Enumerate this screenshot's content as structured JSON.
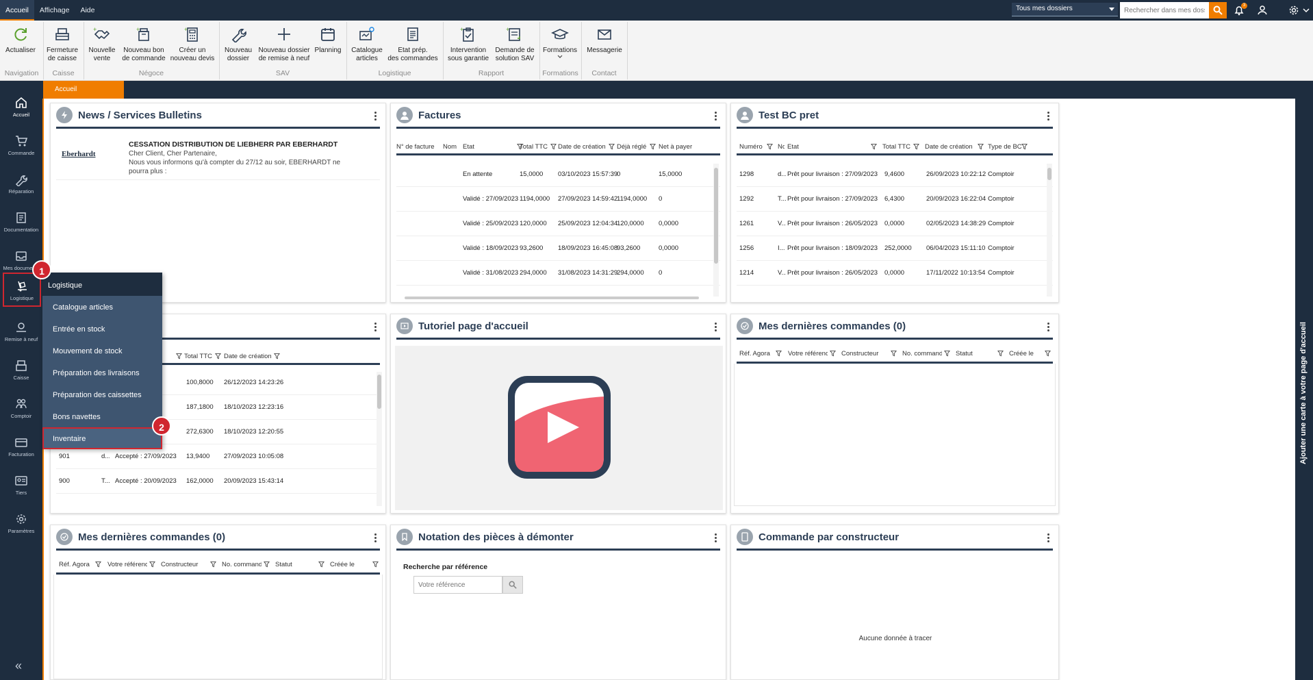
{
  "menubar": {
    "items": [
      "Accueil",
      "Affichage",
      "Aide"
    ]
  },
  "topbar": {
    "dossier_select": "Tous mes dossiers",
    "search_placeholder": "Rechercher dans mes dossiers",
    "notification_count": "3"
  },
  "ribbon": {
    "buttons": {
      "actualiser": "Actualiser",
      "fermeture_l1": "Fermeture",
      "fermeture_l2": "de caisse",
      "nouvelle_vente_l1": "Nouvelle",
      "nouvelle_vente_l2": "vente",
      "bon_cmd_l1": "Nouveau bon",
      "bon_cmd_l2": "de commande",
      "devis_l1": "Créer un",
      "devis_l2": "nouveau devis",
      "nouveau_dossier_l1": "Nouveau",
      "nouveau_dossier_l2": "dossier",
      "remise_l1": "Nouveau dossier",
      "remise_l2": "de remise à neuf",
      "planning": "Planning",
      "catalogue_l1": "Catalogue",
      "catalogue_l2": "articles",
      "etat_l1": "Etat prép.",
      "etat_l2": "des commandes",
      "intervention_l1": "Intervention",
      "intervention_l2": "sous garantie",
      "demande_l1": "Demande de",
      "demande_l2": "solution SAV",
      "formations": "Formations",
      "messagerie": "Messagerie"
    },
    "groups": {
      "navigation": "Navigation",
      "caisse": "Caisse",
      "negoce": "Négoce",
      "sav": "SAV",
      "logistique": "Logistique",
      "rapport": "Rapport",
      "formations": "Formations",
      "contact": "Contact"
    }
  },
  "tab": {
    "active": "Accueil"
  },
  "leftnav": {
    "items": [
      "Accueil",
      "Commande",
      "Réparation",
      "Documentation",
      "Mes documents",
      "Logistique",
      "Remise à neuf",
      "Caisse",
      "Comptoir",
      "Facturation",
      "Tiers",
      "Paramètres"
    ]
  },
  "flyout": {
    "title": "Logistique",
    "items": [
      "Catalogue articles",
      "Entrée en stock",
      "Mouvement de stock",
      "Préparation des livraisons",
      "Préparation des caissettes",
      "Bons navettes",
      "Inventaire"
    ]
  },
  "step_badges": [
    "1",
    "2"
  ],
  "cards": {
    "news": {
      "title": "News / Services Bulletins",
      "logo_text": "Eberhardt",
      "headline": "CESSATION DISTRIBUTION DE LIEBHERR PAR EBERHARDT",
      "line1": "Cher Client, Cher Partenaire,",
      "line2": "Nous vous informons qu'à compter du 27/12 au soir, EBERHARDT ne",
      "line3": "pourra plus :"
    },
    "factures": {
      "title": "Factures",
      "headers": [
        "N° de facture",
        "Nom",
        "Etat",
        "Total TTC",
        "Date de création",
        "Déjà réglé",
        "Net à payer"
      ],
      "rows": [
        [
          "",
          "",
          "En attente",
          "15,0000",
          "03/10/2023 15:57:39",
          "0",
          "15,0000"
        ],
        [
          "",
          "",
          "Validé : 27/09/2023",
          "1194,0000",
          "27/09/2023 14:59:42",
          "1194,0000",
          "0"
        ],
        [
          "",
          "",
          "Validé : 25/09/2023",
          "120,0000",
          "25/09/2023 12:04:34",
          "120,0000",
          "0,0000"
        ],
        [
          "",
          "",
          "Validé : 18/09/2023",
          "93,2600",
          "18/09/2023 16:45:08",
          "93,2600",
          "0,0000"
        ],
        [
          "",
          "",
          "Validé : 31/08/2023",
          "294,0000",
          "31/08/2023 14:31:29",
          "294,0000",
          "0"
        ]
      ]
    },
    "testbc": {
      "title": "Test BC pret",
      "headers": [
        "Numéro",
        "Nom",
        "Etat",
        "Total TTC",
        "Date de création",
        "Type de BC"
      ],
      "rows": [
        [
          "1298",
          "d...",
          "Prêt pour livraison : 27/09/2023",
          "9,4600",
          "26/09/2023 10:22:12",
          "Comptoir"
        ],
        [
          "1292",
          "T...",
          "Prêt pour livraison : 27/09/2023",
          "6,4300",
          "20/09/2023 16:22:04",
          "Comptoir"
        ],
        [
          "1261",
          "V...",
          "Prêt pour livraison : 26/05/2023",
          "0,0000",
          "02/05/2023 14:38:29",
          "Comptoir"
        ],
        [
          "1256",
          "I...",
          "Prêt pour livraison : 18/09/2023",
          "252,0000",
          "06/04/2023 15:11:10",
          "Comptoir"
        ],
        [
          "1214",
          "V...",
          "Prêt pour livraison : 26/05/2023",
          "0,0000",
          "17/11/2022 10:13:54",
          "Comptoir"
        ]
      ]
    },
    "devis": {
      "headers": [
        "Total TTC",
        "Date de création"
      ],
      "rows": [
        [
          "",
          "",
          "",
          "100,8000",
          "26/12/2023 14:23:26"
        ],
        [
          "",
          "",
          "",
          "187,1800",
          "18/10/2023 12:23:16"
        ],
        [
          "",
          "",
          "",
          "272,6300",
          "18/10/2023 12:20:55"
        ],
        [
          "901",
          "d...",
          "Accepté : 27/09/2023",
          "13,9400",
          "27/09/2023 10:05:08"
        ],
        [
          "900",
          "T...",
          "Accepté : 20/09/2023",
          "162,0000",
          "20/09/2023 15:43:14"
        ]
      ]
    },
    "tutoriel": {
      "title": "Tutoriel page d'accueil"
    },
    "cmd_right": {
      "title": "Mes dernières commandes (0)",
      "headers": [
        "Réf. Agora",
        "Votre référence",
        "Constructeur",
        "No. commande",
        "Statut",
        "Créée le"
      ]
    },
    "cmd_left": {
      "title": "Mes dernières commandes (0)",
      "headers": [
        "Réf. Agora",
        "Votre référence",
        "Constructeur",
        "No. commande",
        "Statut",
        "Créée le"
      ]
    },
    "notation": {
      "title": "Notation des pièces à démonter",
      "label": "Recherche par référence",
      "placeholder": "Votre référence"
    },
    "constructeur": {
      "title": "Commande par constructeur",
      "empty": "Aucune donnée à tracer"
    }
  },
  "right_strip": "Ajouter une carte à votre page d'accueil",
  "colors": {
    "navy": "#1e2d3f",
    "accent": "#f07d00",
    "highlight": "#d0262f",
    "youtube": "#f06472"
  }
}
